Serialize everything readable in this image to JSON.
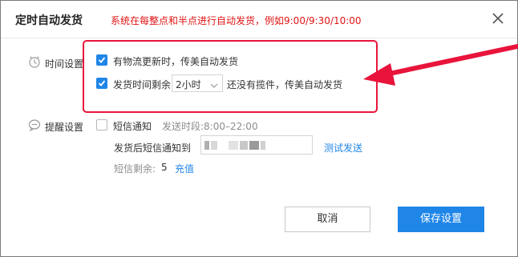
{
  "dialog": {
    "title": "定时自动发货",
    "notice": "系统在每整点和半点进行自动发货，例如9:00/9:30/10:00"
  },
  "time_settings": {
    "label": "时间设置",
    "option1_text": "有物流更新时，传美自动发货",
    "option1_checked": true,
    "option2_prefix": "发货时间剩余",
    "option2_checked": true,
    "select_value": "2小时",
    "option2_suffix": "还没有揽件，传美自动发货"
  },
  "reminder_settings": {
    "label": "提醒设置",
    "sms_label": "短信通知",
    "sms_checked": false,
    "send_period": "发送时段:8:00–22:00",
    "notify_label": "发货后短信通知到",
    "test_send": "测试发送",
    "remaining_label": "短信剩余:",
    "remaining_count": "5",
    "recharge": "充值"
  },
  "buttons": {
    "cancel": "取消",
    "save": "保存设置"
  },
  "colors": {
    "accent": "#1f86e8",
    "notice": "#e01414",
    "annotation": "#e8143c"
  },
  "icons": {
    "close": "close-icon",
    "time": "stopwatch-icon",
    "reminder": "chat-bubble-icon"
  }
}
